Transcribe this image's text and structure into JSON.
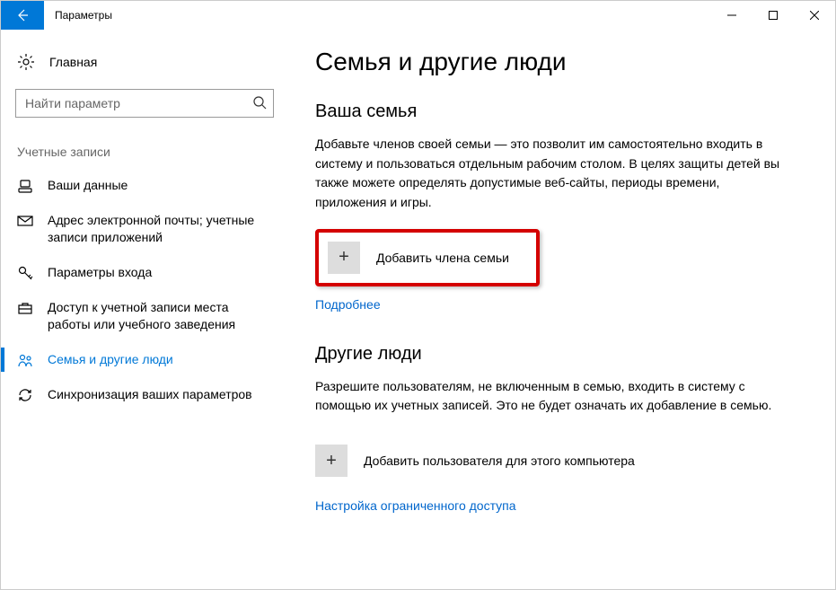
{
  "window": {
    "title": "Параметры"
  },
  "sidebar": {
    "home": "Главная",
    "search_placeholder": "Найти параметр",
    "group": "Учетные записи",
    "items": [
      {
        "label": "Ваши данные"
      },
      {
        "label": "Адрес электронной почты; учетные записи приложений"
      },
      {
        "label": "Параметры входа"
      },
      {
        "label": "Доступ к учетной записи места работы или учебного заведения"
      },
      {
        "label": "Семья и другие люди"
      },
      {
        "label": "Синхронизация ваших параметров"
      }
    ]
  },
  "main": {
    "page_title": "Семья и другие люди",
    "family": {
      "heading": "Ваша семья",
      "body": "Добавьте членов своей семьи — это позволит им самостоятельно входить в систему и пользоваться отдельным рабочим столом. В целях защиты детей вы также можете определять допустимые веб-сайты, периоды времени, приложения и игры.",
      "add_label": "Добавить члена семьи",
      "more": "Подробнее"
    },
    "others": {
      "heading": "Другие люди",
      "body": "Разрешите пользователям, не включенным в семью, входить в систему с помощью их учетных записей. Это не будет означать их добавление в семью.",
      "add_label": "Добавить пользователя для этого компьютера",
      "restricted": "Настройка ограниченного доступа"
    }
  }
}
